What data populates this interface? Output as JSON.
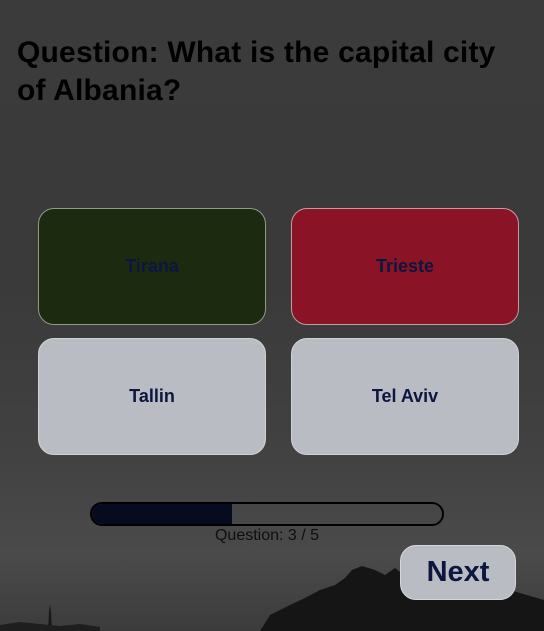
{
  "question": {
    "text": "Question: What is the capital city of Albania?"
  },
  "answers": [
    {
      "label": "Tirana",
      "state": "correct"
    },
    {
      "label": "Trieste",
      "state": "wrong"
    },
    {
      "label": "Tallin",
      "state": "neutral"
    },
    {
      "label": "Tel Aviv",
      "state": "neutral"
    }
  ],
  "progress": {
    "label": "Question: 3 / 5",
    "fraction": 0.4
  },
  "next_button": {
    "label": "Next"
  },
  "colors": {
    "correct": "#1c2a10",
    "wrong": "#8a1425",
    "neutral": "#b9bcc3",
    "text_dark": "#0c1640"
  }
}
